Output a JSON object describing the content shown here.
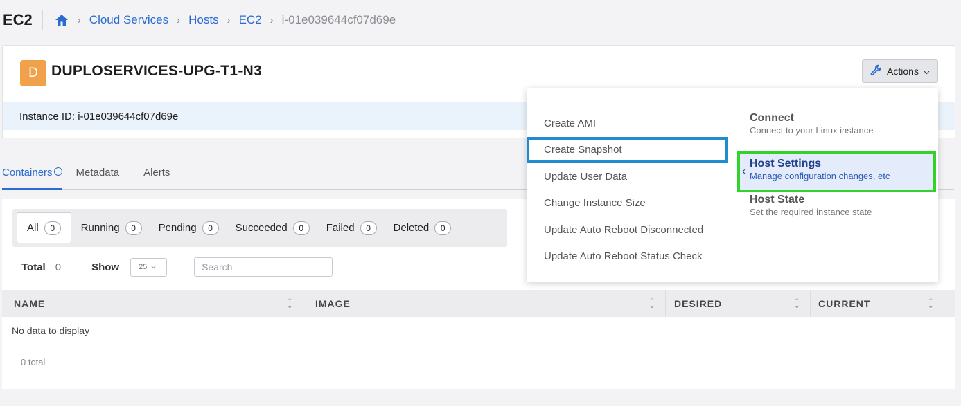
{
  "topbar": {
    "app_title": "EC2",
    "breadcrumbs": [
      "Cloud Services",
      "Hosts",
      "EC2"
    ],
    "current": "i-01e039644cf07d69e"
  },
  "header": {
    "avatar_letter": "D",
    "host_name": "DUPLOSERVICES-UPG-T1-N3",
    "actions_label": "Actions",
    "instance_id_text": "Instance ID: i-01e039644cf07d69e"
  },
  "tabs": [
    {
      "label": "Containers",
      "active": true
    },
    {
      "label": "Metadata"
    },
    {
      "label": "Alerts"
    }
  ],
  "filters": [
    {
      "label": "All",
      "count": "0"
    },
    {
      "label": "Running",
      "count": "0"
    },
    {
      "label": "Pending",
      "count": "0"
    },
    {
      "label": "Succeeded",
      "count": "0"
    },
    {
      "label": "Failed",
      "count": "0"
    },
    {
      "label": "Deleted",
      "count": "0"
    }
  ],
  "toolbar": {
    "total_label": "Total",
    "total_value": "0",
    "show_label": "Show",
    "page_size": "25",
    "search_placeholder": "Search"
  },
  "table": {
    "columns": [
      "NAME",
      "IMAGE",
      "DESIRED",
      "CURRENT"
    ],
    "empty_text": "No data to display",
    "footer_total": "0 total"
  },
  "actions_menu": {
    "items": [
      "Create AMI",
      "Create Snapshot",
      "Update User Data",
      "Change Instance Size",
      "Update Auto Reboot Disconnected",
      "Update Auto Reboot Status Check"
    ],
    "highlighted_item": "Create Snapshot",
    "groups": [
      {
        "title": "Connect",
        "subtitle": "Connect to your Linux instance"
      },
      {
        "title": "Host Settings",
        "subtitle": "Manage configuration changes, etc"
      },
      {
        "title": "Host State",
        "subtitle": "Set the required instance state"
      }
    ],
    "selected_group": "Host Settings"
  },
  "colors": {
    "accent": "#2b6cd1",
    "avatar": "#f0a149",
    "highlight_blue": "#1f8ccf",
    "highlight_green": "#33d12c"
  },
  "icons": {
    "home": "home-icon",
    "wrench": "wrench-icon",
    "info": "info-icon",
    "sort": "sort-icon",
    "chevron": "chevron-down-icon"
  }
}
